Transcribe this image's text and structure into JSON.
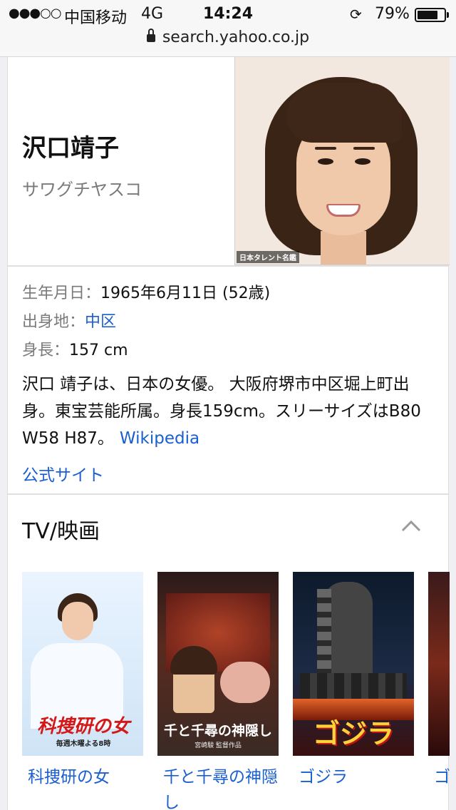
{
  "status_bar": {
    "signal": "●●●○○",
    "carrier": "中国移动",
    "network": "4G",
    "time": "14:24",
    "battery_percent": "79%",
    "battery_level": 0.79
  },
  "url_bar": {
    "url": "search.yahoo.co.jp"
  },
  "person": {
    "name": "沢口靖子",
    "kana": "サワグチヤスコ",
    "photo_credit": "日本タレント名鑑"
  },
  "facts": {
    "birth_label": "生年月日：",
    "birth_value": "1965年6月11日 (52歳)",
    "origin_label": "出身地：",
    "origin_value": "中区",
    "height_label": "身長：",
    "height_value": "157 cm"
  },
  "description": {
    "text": "沢口 靖子は、日本の女優。 大阪府堺市中区堀上町出身。東宝芸能所属。身長159cm。スリーサイズはB80 W58 H87。",
    "source_link": "Wikipedia",
    "official_link": "公式サイト"
  },
  "tv_section": {
    "title": "TV/映画",
    "items": [
      {
        "label": "科捜研の女",
        "poster_title": "科捜研の女",
        "poster_sub": "毎週木曜よる8時"
      },
      {
        "label": "千と千尋の神隠し",
        "poster_title": "千と千尋の神隠し",
        "poster_sub": "宮崎駿 監督作品"
      },
      {
        "label": "ゴジラ",
        "poster_title": "ゴジラ",
        "poster_sub": ""
      },
      {
        "label": "ゴ",
        "poster_title": "",
        "poster_sub": ""
      }
    ]
  },
  "icons": {
    "lock": "lock-icon",
    "rotation_lock": "rotation-lock-icon",
    "collapse": "chevron-up-icon"
  },
  "colors": {
    "link": "#1a5fd0",
    "label_gray": "#7a7a7a"
  }
}
